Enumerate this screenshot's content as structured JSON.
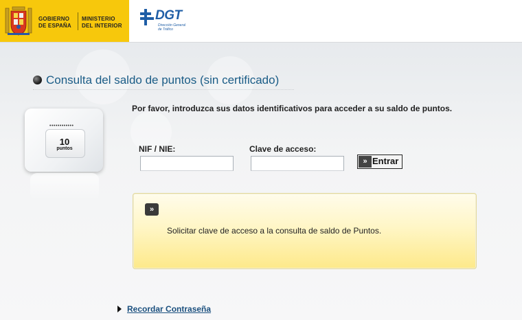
{
  "header": {
    "gov_line1": "GOBIERNO",
    "gov_line2": "DE ESPAÑA",
    "ministry_line1": "MINISTERIO",
    "ministry_line2": "DEL INTERIOR",
    "dgt_name": "DGT",
    "dgt_sub1": "Dirección General",
    "dgt_sub2": "de Tráfico",
    "colors": {
      "gov_yellow": "#f7c80c",
      "dgt_blue": "#1f5ea6"
    }
  },
  "page": {
    "title": "Consulta del saldo de puntos (sin certificado)",
    "intro": "Por favor, introduzca sus datos identificativos para acceder a su saldo de puntos."
  },
  "card": {
    "points": "10",
    "unit": "puntos",
    "dots": "••••••••••••"
  },
  "form": {
    "nif_label": "NIF / NIE:",
    "nif_value": "",
    "clave_label": "Clave de acceso:",
    "clave_value": "",
    "submit_arrow": "»",
    "submit_label": "Entrar"
  },
  "panel": {
    "button_arrow": "»",
    "text": "Solicitar clave de acceso a la consulta de saldo de Puntos."
  },
  "footer_link": {
    "label": "Recordar Contraseña"
  }
}
